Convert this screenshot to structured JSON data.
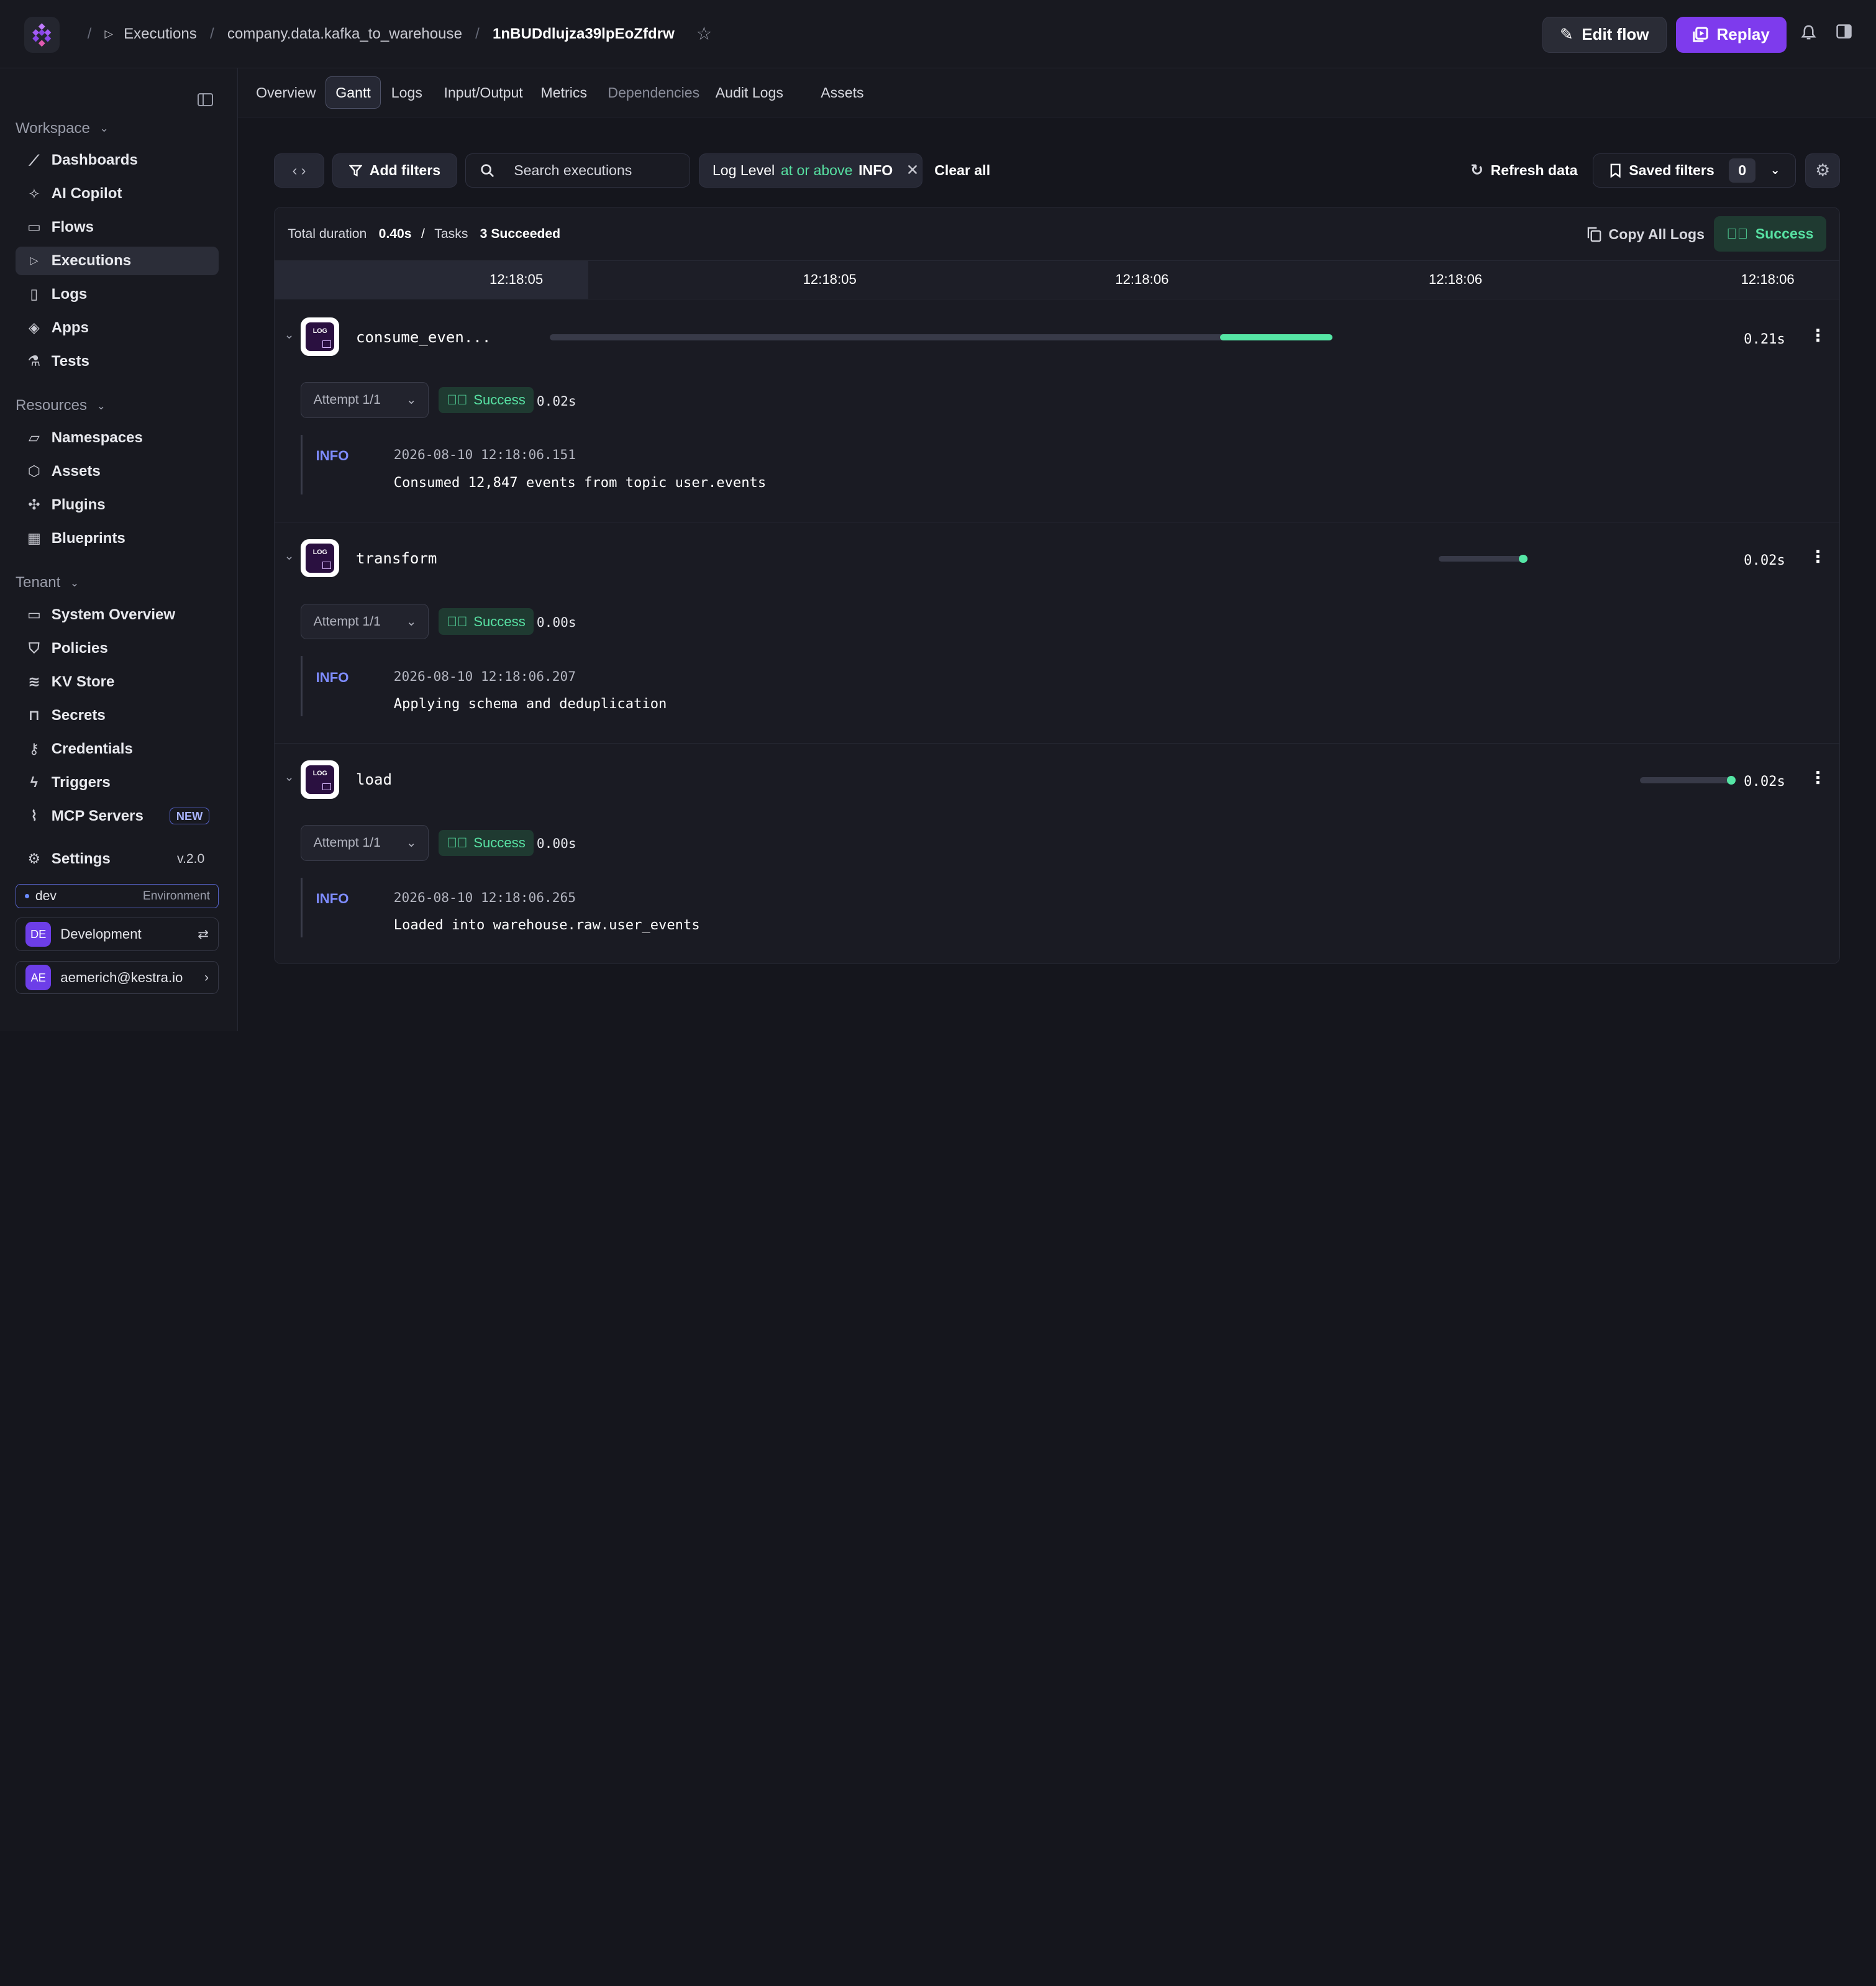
{
  "header": {
    "breadcrumbs": [
      "Executions",
      "company.data.kafka_to_warehouse",
      "1nBUDdlujza39lpEoZfdrw"
    ],
    "edit_flow_label": "Edit flow",
    "replay_label": "Replay"
  },
  "sidebar": {
    "sections": {
      "workspace": "Workspace",
      "resources": "Resources",
      "tenant": "Tenant"
    },
    "workspace_items": [
      {
        "label": "Dashboards",
        "icon": "chart-line-icon"
      },
      {
        "label": "AI Copilot",
        "icon": "sparkle-icon"
      },
      {
        "label": "Flows",
        "icon": "folder-icon"
      },
      {
        "label": "Executions",
        "icon": "play-icon",
        "active": true
      },
      {
        "label": "Logs",
        "icon": "document-icon"
      },
      {
        "label": "Apps",
        "icon": "layers-icon"
      },
      {
        "label": "Tests",
        "icon": "flask-icon"
      }
    ],
    "resource_items": [
      {
        "label": "Namespaces",
        "icon": "folder-open-icon"
      },
      {
        "label": "Assets",
        "icon": "cube-icon"
      },
      {
        "label": "Plugins",
        "icon": "puzzle-icon"
      },
      {
        "label": "Blueprints",
        "icon": "grid-icon"
      }
    ],
    "tenant_items": [
      {
        "label": "System Overview",
        "icon": "monitor-icon"
      },
      {
        "label": "Policies",
        "icon": "shield-icon"
      },
      {
        "label": "KV Store",
        "icon": "database-icon"
      },
      {
        "label": "Secrets",
        "icon": "lock-icon"
      },
      {
        "label": "Credentials",
        "icon": "key-icon"
      },
      {
        "label": "Triggers",
        "icon": "bolt-icon"
      },
      {
        "label": "MCP Servers",
        "icon": "mcp-icon",
        "badge": "NEW"
      }
    ],
    "settings_label": "Settings",
    "version": "v.2.0",
    "environment": {
      "name": "dev",
      "label": "Environment"
    },
    "tenant_switch": {
      "initials": "DE",
      "name": "Development"
    },
    "user": {
      "initials": "AE",
      "email": "aemerich@kestra.io"
    }
  },
  "tabs": [
    "Overview",
    "Gantt",
    "Logs",
    "Input/Output",
    "Metrics",
    "Dependencies",
    "Audit Logs",
    "Assets"
  ],
  "active_tab": "Gantt",
  "filters": {
    "add_filters_label": "Add filters",
    "search_placeholder": "Search executions",
    "chip": {
      "key": "Log Level",
      "op": "at or above",
      "value": "INFO"
    },
    "clear_all_label": "Clear all",
    "refresh_label": "Refresh data",
    "saved_filters_label": "Saved filters",
    "saved_filters_count": "0"
  },
  "summary": {
    "total_duration_label": "Total duration",
    "total_duration": "0.40s",
    "sep": "/",
    "tasks_label": "Tasks",
    "tasks_status": "3 Succeeded",
    "copy_logs_label": "Copy All Logs",
    "status": "Success"
  },
  "timeline_ticks": [
    "12:18:05",
    "12:18:05",
    "12:18:06",
    "12:18:06",
    "12:18:06"
  ],
  "tasks": [
    {
      "name": "consume_even...",
      "duration": "0.21s",
      "attempt": "Attempt 1/1",
      "status": "Success",
      "attempt_duration": "0.02s",
      "log": {
        "level": "INFO",
        "timestamp": "2026-08-10 12:18:06.151",
        "message": "Consumed 12,847 events from topic user.events"
      }
    },
    {
      "name": "transform",
      "duration": "0.02s",
      "attempt": "Attempt 1/1",
      "status": "Success",
      "attempt_duration": "0.00s",
      "log": {
        "level": "INFO",
        "timestamp": "2026-08-10 12:18:06.207",
        "message": "Applying schema and deduplication"
      }
    },
    {
      "name": "load",
      "duration": "0.02s",
      "attempt": "Attempt 1/1",
      "status": "Success",
      "attempt_duration": "0.00s",
      "log": {
        "level": "INFO",
        "timestamp": "2026-08-10 12:18:06.265",
        "message": "Loaded into warehouse.raw.user_events"
      }
    }
  ]
}
